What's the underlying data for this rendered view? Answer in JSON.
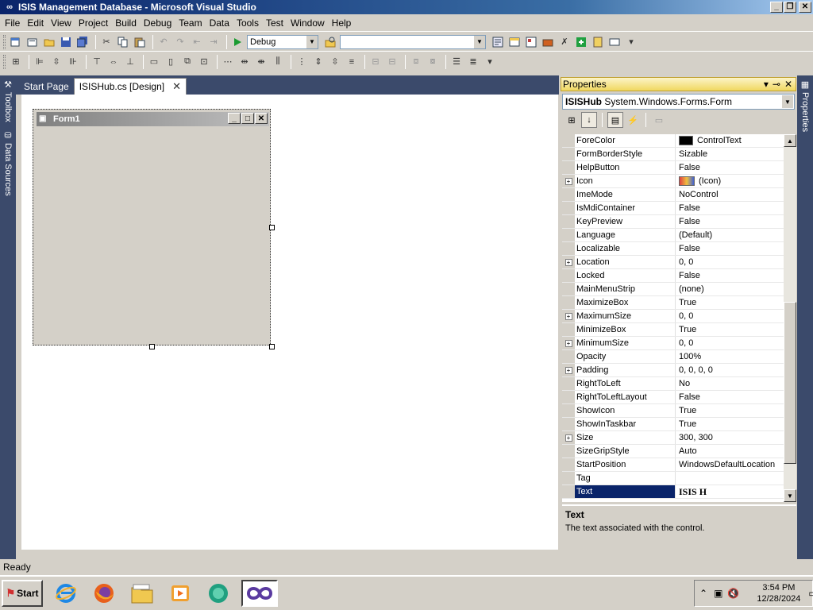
{
  "window": {
    "title": "ISIS Management Database - Microsoft Visual Studio",
    "minimize": "_",
    "restore": "❐",
    "close": "✕"
  },
  "menu": [
    "File",
    "Edit",
    "View",
    "Project",
    "Build",
    "Debug",
    "Team",
    "Data",
    "Tools",
    "Test",
    "Window",
    "Help"
  ],
  "toolbar": {
    "config": "Debug",
    "platform": ""
  },
  "side_tabs": {
    "toolbox": "Toolbox",
    "data_sources": "Data Sources",
    "properties": "Properties"
  },
  "doc_tabs": {
    "start": "Start Page",
    "design": "ISISHub.cs [Design]",
    "close": "✕"
  },
  "form": {
    "title": "Form1"
  },
  "properties": {
    "title": "Properties",
    "object_name": "ISISHub",
    "object_type": "System.Windows.Forms.Form",
    "rows": [
      {
        "name": "ForeColor",
        "value": "ControlText",
        "expandable": false
      },
      {
        "name": "FormBorderStyle",
        "value": "Sizable",
        "expandable": false
      },
      {
        "name": "HelpButton",
        "value": "False",
        "expandable": false
      },
      {
        "name": "Icon",
        "value": "(Icon)",
        "expandable": true
      },
      {
        "name": "ImeMode",
        "value": "NoControl",
        "expandable": false
      },
      {
        "name": "IsMdiContainer",
        "value": "False",
        "expandable": false
      },
      {
        "name": "KeyPreview",
        "value": "False",
        "expandable": false
      },
      {
        "name": "Language",
        "value": "(Default)",
        "expandable": false
      },
      {
        "name": "Localizable",
        "value": "False",
        "expandable": false
      },
      {
        "name": "Location",
        "value": "0, 0",
        "expandable": true
      },
      {
        "name": "Locked",
        "value": "False",
        "expandable": false
      },
      {
        "name": "MainMenuStrip",
        "value": "(none)",
        "expandable": false
      },
      {
        "name": "MaximizeBox",
        "value": "True",
        "expandable": false
      },
      {
        "name": "MaximumSize",
        "value": "0, 0",
        "expandable": true
      },
      {
        "name": "MinimizeBox",
        "value": "True",
        "expandable": false
      },
      {
        "name": "MinimumSize",
        "value": "0, 0",
        "expandable": true
      },
      {
        "name": "Opacity",
        "value": "100%",
        "expandable": false
      },
      {
        "name": "Padding",
        "value": "0, 0, 0, 0",
        "expandable": true
      },
      {
        "name": "RightToLeft",
        "value": "No",
        "expandable": false
      },
      {
        "name": "RightToLeftLayout",
        "value": "False",
        "expandable": false
      },
      {
        "name": "ShowIcon",
        "value": "True",
        "expandable": false
      },
      {
        "name": "ShowInTaskbar",
        "value": "True",
        "expandable": false
      },
      {
        "name": "Size",
        "value": "300, 300",
        "expandable": true
      },
      {
        "name": "SizeGripStyle",
        "value": "Auto",
        "expandable": false
      },
      {
        "name": "StartPosition",
        "value": "WindowsDefaultLocation",
        "expandable": false
      },
      {
        "name": "Tag",
        "value": "",
        "expandable": false
      },
      {
        "name": "Text",
        "value": "ISIS H",
        "expandable": false,
        "selected": true
      }
    ],
    "description_title": "Text",
    "description": "The text associated with the control."
  },
  "status": "Ready",
  "taskbar": {
    "start": "Start",
    "time": "3:54 PM",
    "date": "12/28/2024"
  }
}
